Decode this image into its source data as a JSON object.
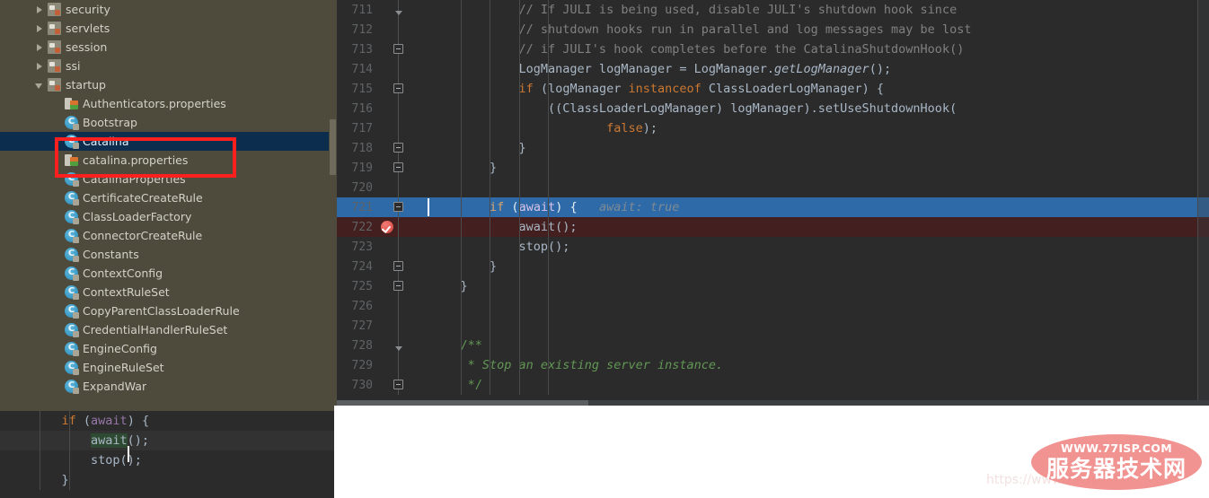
{
  "colors": {
    "tree_bg": "#4e4b3c",
    "tree_selected_bg": "#0d2d4e",
    "editor_bg": "#2b2b2b",
    "exec_line_bg": "#2f6aa8",
    "breakpoint_line_bg": "#431f1f",
    "annotation_red": "#fe1f1f",
    "watermark_pink": "#f08a88",
    "line_number_fg": "#606366",
    "comment_fg": "#808080",
    "keyword_fg": "#cc7832",
    "javadoc_fg": "#629755",
    "field_fg": "#9876aa",
    "default_fg": "#a9b7c6"
  },
  "tree": {
    "name": "project-tree",
    "items": [
      {
        "label": "security",
        "indent": 1,
        "twisty": "collapsed",
        "icon": "package-icon",
        "selected": false
      },
      {
        "label": "servlets",
        "indent": 1,
        "twisty": "collapsed",
        "icon": "package-icon",
        "selected": false
      },
      {
        "label": "session",
        "indent": 1,
        "twisty": "collapsed",
        "icon": "package-icon",
        "selected": false
      },
      {
        "label": "ssi",
        "indent": 1,
        "twisty": "collapsed",
        "icon": "package-icon",
        "selected": false
      },
      {
        "label": "startup",
        "indent": 1,
        "twisty": "expanded",
        "icon": "package-icon",
        "selected": false
      },
      {
        "label": "Authenticators.properties",
        "indent": 2,
        "twisty": "none",
        "icon": "properties-icon",
        "selected": false
      },
      {
        "label": "Bootstrap",
        "indent": 2,
        "twisty": "none",
        "icon": "class-icon",
        "selected": false
      },
      {
        "label": "Catalina",
        "indent": 2,
        "twisty": "none",
        "icon": "class-icon",
        "selected": true
      },
      {
        "label": "catalina.properties",
        "indent": 2,
        "twisty": "none",
        "icon": "properties-icon",
        "selected": false
      },
      {
        "label": "CatalinaProperties",
        "indent": 2,
        "twisty": "none",
        "icon": "class-icon",
        "selected": false
      },
      {
        "label": "CertificateCreateRule",
        "indent": 2,
        "twisty": "none",
        "icon": "class-icon",
        "selected": false
      },
      {
        "label": "ClassLoaderFactory",
        "indent": 2,
        "twisty": "none",
        "icon": "class-icon",
        "selected": false
      },
      {
        "label": "ConnectorCreateRule",
        "indent": 2,
        "twisty": "none",
        "icon": "class-icon",
        "selected": false
      },
      {
        "label": "Constants",
        "indent": 2,
        "twisty": "none",
        "icon": "class-icon",
        "selected": false
      },
      {
        "label": "ContextConfig",
        "indent": 2,
        "twisty": "none",
        "icon": "class-icon",
        "selected": false
      },
      {
        "label": "ContextRuleSet",
        "indent": 2,
        "twisty": "none",
        "icon": "class-icon",
        "selected": false
      },
      {
        "label": "CopyParentClassLoaderRule",
        "indent": 2,
        "twisty": "none",
        "icon": "class-icon",
        "selected": false
      },
      {
        "label": "CredentialHandlerRuleSet",
        "indent": 2,
        "twisty": "none",
        "icon": "class-icon",
        "selected": false
      },
      {
        "label": "EngineConfig",
        "indent": 2,
        "twisty": "none",
        "icon": "class-icon",
        "selected": false
      },
      {
        "label": "EngineRuleSet",
        "indent": 2,
        "twisty": "none",
        "icon": "class-icon",
        "selected": false
      },
      {
        "label": "ExpandWar",
        "indent": 2,
        "twisty": "none",
        "icon": "class-icon",
        "selected": false
      }
    ]
  },
  "annotation": {
    "name": "red-highlight-box",
    "covers": [
      "Catalina",
      "catalina.properties"
    ]
  },
  "editor": {
    "name": "code-editor",
    "lines": [
      {
        "number": "711",
        "gutter": "fold-arrow-down",
        "highlight": "none",
        "tokens": [
          {
            "text": "            // If JULI is being used, disable JULI's shutdown hook since",
            "style": "comment"
          }
        ]
      },
      {
        "number": "712",
        "gutter": "fold-line",
        "highlight": "none",
        "tokens": [
          {
            "text": "            // shutdown hooks run in parallel and log messages may be lost",
            "style": "comment"
          }
        ]
      },
      {
        "number": "713",
        "gutter": "fold-minus",
        "highlight": "none",
        "tokens": [
          {
            "text": "            // if JULI's hook completes before the CatalinaShutdownHook()",
            "style": "comment"
          }
        ]
      },
      {
        "number": "714",
        "gutter": "fold-line",
        "highlight": "none",
        "tokens": [
          {
            "text": "            LogManager logManager = LogManager.",
            "style": "plain"
          },
          {
            "text": "getLogManager",
            "style": "method"
          },
          {
            "text": "();",
            "style": "plain"
          }
        ]
      },
      {
        "number": "715",
        "gutter": "fold-minus",
        "highlight": "none",
        "tokens": [
          {
            "text": "            ",
            "style": "plain"
          },
          {
            "text": "if",
            "style": "keyword"
          },
          {
            "text": " (logManager ",
            "style": "plain"
          },
          {
            "text": "instanceof",
            "style": "keyword"
          },
          {
            "text": " ClassLoaderLogManager) {",
            "style": "plain"
          }
        ]
      },
      {
        "number": "716",
        "gutter": "fold-line",
        "highlight": "none",
        "tokens": [
          {
            "text": "                ((ClassLoaderLogManager) logManager).setUseShutdownHook(",
            "style": "plain"
          }
        ]
      },
      {
        "number": "717",
        "gutter": "fold-line",
        "highlight": "none",
        "tokens": [
          {
            "text": "                        ",
            "style": "plain"
          },
          {
            "text": "false",
            "style": "keyword"
          },
          {
            "text": ");",
            "style": "plain"
          }
        ]
      },
      {
        "number": "718",
        "gutter": "fold-minus",
        "highlight": "none",
        "tokens": [
          {
            "text": "            }",
            "style": "plain"
          }
        ]
      },
      {
        "number": "719",
        "gutter": "fold-minus",
        "highlight": "none",
        "tokens": [
          {
            "text": "        }",
            "style": "plain"
          }
        ]
      },
      {
        "number": "720",
        "gutter": "fold-line",
        "highlight": "none",
        "tokens": [
          {
            "text": "",
            "style": "plain"
          }
        ]
      },
      {
        "number": "721",
        "gutter": "fold-minus-exec",
        "highlight": "blue",
        "tokens": [
          {
            "text": "        ",
            "style": "sel-plain"
          },
          {
            "text": "if",
            "style": "sel-keyword"
          },
          {
            "text": " (",
            "style": "sel-plain"
          },
          {
            "text": "await",
            "style": "sel-field"
          },
          {
            "text": ") {   ",
            "style": "sel-plain"
          },
          {
            "text": "await: true",
            "style": "hint"
          }
        ]
      },
      {
        "number": "722",
        "gutter": "breakpoint",
        "highlight": "red",
        "tokens": [
          {
            "text": "            await();",
            "style": "plain"
          }
        ]
      },
      {
        "number": "723",
        "gutter": "fold-line",
        "highlight": "none",
        "tokens": [
          {
            "text": "            stop();",
            "style": "plain"
          }
        ]
      },
      {
        "number": "724",
        "gutter": "fold-minus",
        "highlight": "none",
        "tokens": [
          {
            "text": "        }",
            "style": "plain"
          }
        ]
      },
      {
        "number": "725",
        "gutter": "fold-minus",
        "highlight": "none",
        "tokens": [
          {
            "text": "    }",
            "style": "plain"
          }
        ]
      },
      {
        "number": "726",
        "gutter": "fold-line",
        "highlight": "none",
        "tokens": [
          {
            "text": "",
            "style": "plain"
          }
        ]
      },
      {
        "number": "727",
        "gutter": "fold-line",
        "highlight": "none",
        "tokens": [
          {
            "text": "",
            "style": "plain"
          }
        ]
      },
      {
        "number": "728",
        "gutter": "fold-arrow-down",
        "highlight": "none",
        "tokens": [
          {
            "text": "    /**",
            "style": "docmark"
          }
        ]
      },
      {
        "number": "729",
        "gutter": "fold-line",
        "highlight": "none",
        "tokens": [
          {
            "text": "     * ",
            "style": "docmark"
          },
          {
            "text": "Stop an existing server instance.",
            "style": "doc"
          }
        ]
      },
      {
        "number": "730",
        "gutter": "fold-minus",
        "highlight": "none",
        "tokens": [
          {
            "text": "     */",
            "style": "docmark"
          }
        ]
      }
    ]
  },
  "preview": {
    "name": "code-preview-panel",
    "lines": [
      {
        "highlight": false,
        "tokens": [
          {
            "text": "    ",
            "style": "plain"
          },
          {
            "text": "if",
            "style": "keyword"
          },
          {
            "text": " (",
            "style": "plain"
          },
          {
            "text": "await",
            "style": "field"
          },
          {
            "text": ") {",
            "style": "plain"
          }
        ]
      },
      {
        "highlight": true,
        "caret": true,
        "tokens": [
          {
            "text": "        ",
            "style": "plain"
          },
          {
            "text": "await",
            "style": "selection"
          },
          {
            "text": "();",
            "style": "plain"
          }
        ]
      },
      {
        "highlight": false,
        "tokens": [
          {
            "text": "        stop();",
            "style": "plain"
          }
        ]
      },
      {
        "highlight": false,
        "tokens": [
          {
            "text": "    }",
            "style": "plain"
          }
        ]
      }
    ]
  },
  "watermark": {
    "name": "site-watermark",
    "url": "WWW.77ISP.COM",
    "title": "服务器技术网",
    "faint_url": "https://www.77isp.com"
  }
}
